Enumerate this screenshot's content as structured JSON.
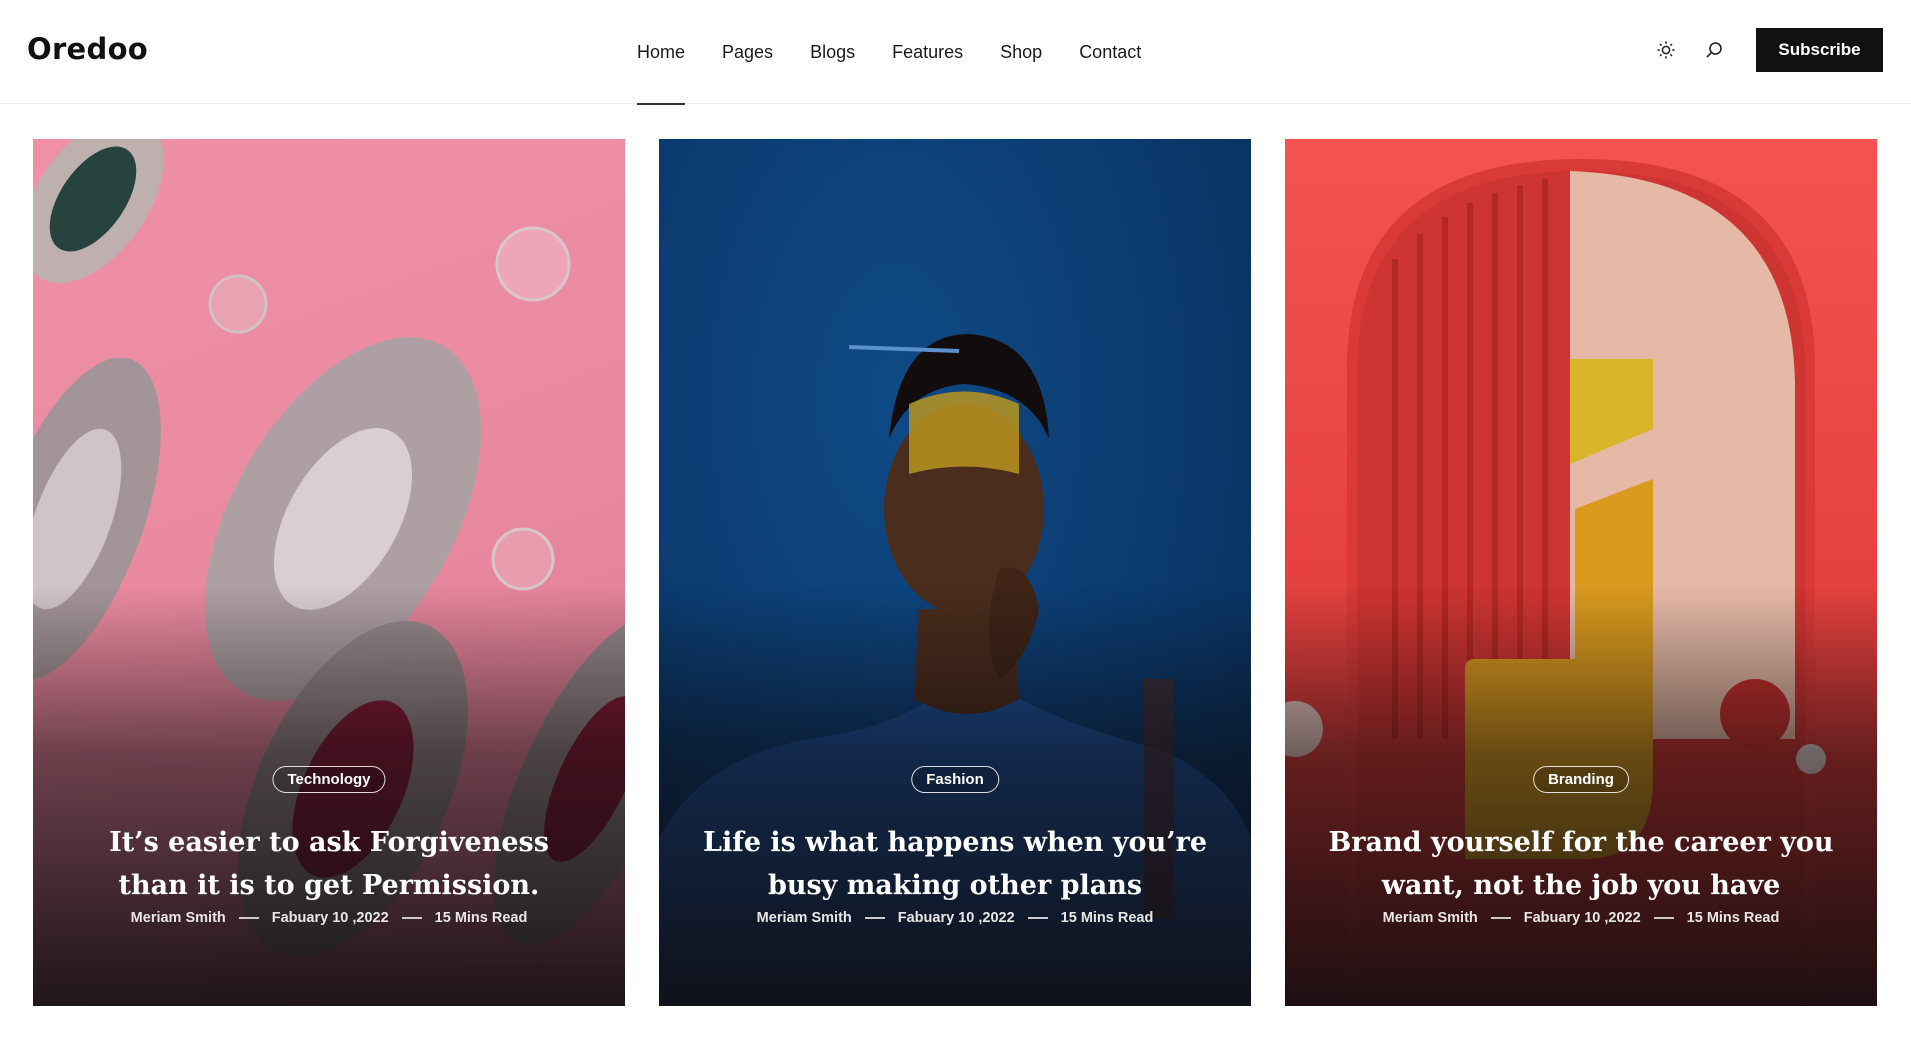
{
  "brand": {
    "logo": "Oredoo"
  },
  "nav": {
    "items": [
      {
        "label": "Home",
        "active": true
      },
      {
        "label": "Pages",
        "active": false
      },
      {
        "label": "Blogs",
        "active": false
      },
      {
        "label": "Features",
        "active": false
      },
      {
        "label": "Shop",
        "active": false
      },
      {
        "label": "Contact",
        "active": false
      }
    ]
  },
  "tools": {
    "theme_icon": "sun-icon",
    "search_icon": "search-icon",
    "subscribe_label": "Subscribe"
  },
  "cards": [
    {
      "category": "Technology",
      "title": "It’s easier to ask Forgiveness than it is to get Permission.",
      "author": "Meriam Smith",
      "date": "Fabuary 10 ,2022",
      "read_time": "15 Mins Read"
    },
    {
      "category": "Fashion",
      "title": "Life is what happens when you’re busy making other plans",
      "author": "Meriam Smith",
      "date": "Fabuary 10 ,2022",
      "read_time": "15 Mins Read"
    },
    {
      "category": "Branding",
      "title": "Brand yourself for the career you want, not the job you have",
      "author": "Meriam Smith",
      "date": "Fabuary 10 ,2022",
      "read_time": "15 Mins Read"
    }
  ],
  "colors": {
    "subscribe_bg": "#111111",
    "card1_bg": "#ea8aa0",
    "card2_bg": "#0b3a6e",
    "card3_bg": "#e5423f"
  }
}
